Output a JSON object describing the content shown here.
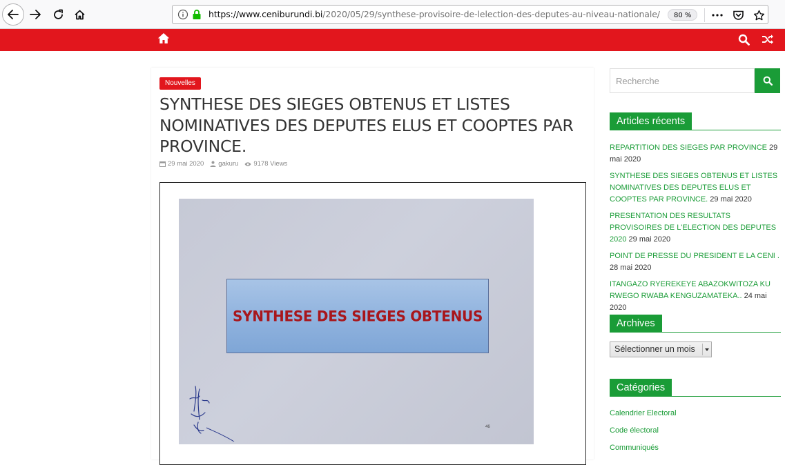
{
  "browser": {
    "url_host": "https://www.ceniburundi.bi",
    "url_path": "/2020/05/29/synthese-provisoire-de-lelection-des-deputes-au-niveau-nationale/",
    "zoom": "80 %",
    "icons": [
      "back-icon",
      "forward-icon",
      "reload-icon",
      "home-icon",
      "info-icon",
      "lock-icon",
      "more-icon",
      "pocket-icon",
      "bookmark-star-icon"
    ]
  },
  "topbar": {
    "color": "#e2161d",
    "icons": [
      "home-icon",
      "search-icon",
      "shuffle-icon"
    ]
  },
  "article": {
    "category": "Nouvelles",
    "title": "SYNTHESE DES SIEGES OBTENUS ET LISTES NOMINATIVES DES DEPUTES ELUS ET COOPTES PAR PROVINCE.",
    "date": "29 mai 2020",
    "author": "gakuru",
    "views": "9178 Views",
    "figure": {
      "banner_text": "SYNTHESE DES SIEGES OBTENUS",
      "page_number": "46"
    }
  },
  "sidebar": {
    "accent": "#1a9c37",
    "search_placeholder": "Recherche",
    "recent": {
      "title": "Articles récents",
      "items": [
        {
          "link": "REPARTITION DES SIEGES PAR PROVINCE",
          "date": " 29 mai 2020"
        },
        {
          "link": "SYNTHESE DES SIEGES OBTENUS ET LISTES NOMINATIVES DES DEPUTES ELUS ET COOPTES PAR PROVINCE.",
          "date": " 29 mai 2020"
        },
        {
          "link": "PRESENTATION DES RESULTATS PROVISOIRES DE L'ELECTION DES DEPUTES 2020",
          "date": " 29 mai 2020"
        },
        {
          "link": "POINT DE PRESSE DU PRESIDENT E LA CENI .",
          "date": " 28 mai 2020"
        },
        {
          "link": "ITANGAZO RYEREKEYE ABAZOKWITOZA KU RWEGO RWABA KENGUZAMATEKA..",
          "date": " 24 mai 2020"
        }
      ]
    },
    "archives": {
      "title": "Archives",
      "select_value": "Sélectionner un mois"
    },
    "categories": {
      "title": "Catégories",
      "items": [
        "Calendrier Electoral",
        "Code électoral",
        "Communiqués"
      ]
    }
  }
}
